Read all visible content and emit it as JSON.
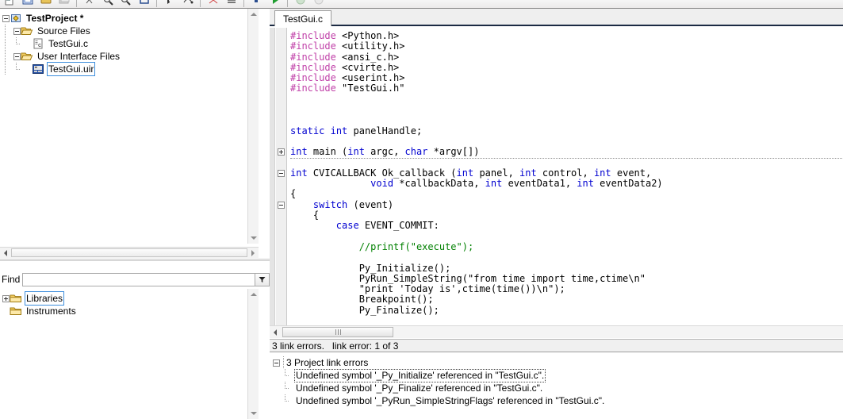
{
  "toolbar": {
    "icons": [
      "new-file-icon",
      "open-file-icon",
      "save-file-icon",
      "save-all-icon",
      "cut-icon",
      "find-icon",
      "find-next-icon",
      "zoom-icon",
      "debug-run-icon",
      "step-over-icon",
      "step-into-icon",
      "breakpoint-icon",
      "compile-icon",
      "run-icon",
      "stop-icon",
      "pause-icon"
    ]
  },
  "project_tree": {
    "nodes": [
      {
        "label": "TestProject *",
        "icon": "project-icon",
        "bold": true,
        "expander": "minus",
        "selected": false,
        "depth": 0
      },
      {
        "label": "Source Files",
        "icon": "folder-open-icon",
        "bold": false,
        "expander": "minus",
        "selected": false,
        "depth": 1
      },
      {
        "label": "TestGui.c",
        "icon": "c-source-icon",
        "bold": false,
        "expander": "none",
        "selected": false,
        "depth": 2
      },
      {
        "label": "User Interface Files",
        "icon": "folder-open-icon",
        "bold": false,
        "expander": "minus",
        "selected": false,
        "depth": 1
      },
      {
        "label": "TestGui.uir",
        "icon": "uir-file-icon",
        "bold": false,
        "expander": "none",
        "selected": true,
        "depth": 2
      }
    ]
  },
  "find": {
    "label": "Find",
    "value": "",
    "placeholder": "",
    "filter_icon": "funnel-icon"
  },
  "library_tree": {
    "nodes": [
      {
        "label": "Libraries",
        "icon": "folder-closed-icon",
        "expander": "plus",
        "selected": true,
        "depth": 0
      },
      {
        "label": "Instruments",
        "icon": "folder-closed-icon",
        "expander": "none",
        "selected": false,
        "depth": 0
      }
    ]
  },
  "editor": {
    "tab_label": "TestGui.c",
    "lines": [
      {
        "fold": "none",
        "segments": [
          {
            "t": "#include",
            "c": "pre"
          },
          {
            "t": " <Python.h>",
            "c": ""
          }
        ]
      },
      {
        "fold": "none",
        "segments": [
          {
            "t": "#include",
            "c": "pre"
          },
          {
            "t": " <utility.h>",
            "c": ""
          }
        ]
      },
      {
        "fold": "none",
        "segments": [
          {
            "t": "#include",
            "c": "pre"
          },
          {
            "t": " <ansi_c.h>",
            "c": ""
          }
        ]
      },
      {
        "fold": "none",
        "segments": [
          {
            "t": "#include",
            "c": "pre"
          },
          {
            "t": " <cvirte.h>",
            "c": ""
          }
        ]
      },
      {
        "fold": "none",
        "segments": [
          {
            "t": "#include",
            "c": "pre"
          },
          {
            "t": " <userint.h>",
            "c": ""
          }
        ]
      },
      {
        "fold": "none",
        "segments": [
          {
            "t": "#include",
            "c": "pre"
          },
          {
            "t": " \"TestGui.h\"",
            "c": ""
          }
        ]
      },
      {
        "fold": "none",
        "segments": [
          {
            "t": "",
            "c": ""
          }
        ]
      },
      {
        "fold": "none",
        "segments": [
          {
            "t": "",
            "c": ""
          }
        ]
      },
      {
        "fold": "none",
        "segments": [
          {
            "t": "",
            "c": ""
          }
        ]
      },
      {
        "fold": "none",
        "segments": [
          {
            "t": "static",
            "c": "kw"
          },
          {
            "t": " ",
            "c": ""
          },
          {
            "t": "int",
            "c": "kw"
          },
          {
            "t": " panelHandle;",
            "c": ""
          }
        ]
      },
      {
        "fold": "none",
        "segments": [
          {
            "t": "",
            "c": ""
          }
        ]
      },
      {
        "fold": "plus",
        "collapsed": true,
        "segments": [
          {
            "t": "int",
            "c": "kw"
          },
          {
            "t": " main (",
            "c": ""
          },
          {
            "t": "int",
            "c": "kw"
          },
          {
            "t": " argc, ",
            "c": ""
          },
          {
            "t": "char",
            "c": "kw"
          },
          {
            "t": " *argv[])",
            "c": ""
          }
        ]
      },
      {
        "fold": "none",
        "segments": [
          {
            "t": "",
            "c": ""
          }
        ]
      },
      {
        "fold": "minus",
        "segments": [
          {
            "t": "int",
            "c": "kw"
          },
          {
            "t": " CVICALLBACK Ok_callback (",
            "c": ""
          },
          {
            "t": "int",
            "c": "kw"
          },
          {
            "t": " panel, ",
            "c": ""
          },
          {
            "t": "int",
            "c": "kw"
          },
          {
            "t": " control, ",
            "c": ""
          },
          {
            "t": "int",
            "c": "kw"
          },
          {
            "t": " event,",
            "c": ""
          }
        ]
      },
      {
        "fold": "none",
        "segments": [
          {
            "t": "              ",
            "c": ""
          },
          {
            "t": "void",
            "c": "kw"
          },
          {
            "t": " *callbackData, ",
            "c": ""
          },
          {
            "t": "int",
            "c": "kw"
          },
          {
            "t": " eventData1, ",
            "c": ""
          },
          {
            "t": "int",
            "c": "kw"
          },
          {
            "t": " eventData2)",
            "c": ""
          }
        ]
      },
      {
        "fold": "none",
        "segments": [
          {
            "t": "{",
            "c": ""
          }
        ]
      },
      {
        "fold": "minus",
        "segments": [
          {
            "t": "    ",
            "c": ""
          },
          {
            "t": "switch",
            "c": "kw"
          },
          {
            "t": " (event)",
            "c": ""
          }
        ]
      },
      {
        "fold": "none",
        "segments": [
          {
            "t": "    {",
            "c": ""
          }
        ]
      },
      {
        "fold": "none",
        "segments": [
          {
            "t": "        ",
            "c": ""
          },
          {
            "t": "case",
            "c": "kw"
          },
          {
            "t": " EVENT_COMMIT:",
            "c": ""
          }
        ]
      },
      {
        "fold": "none",
        "segments": [
          {
            "t": "",
            "c": ""
          }
        ]
      },
      {
        "fold": "none",
        "segments": [
          {
            "t": "            ",
            "c": ""
          },
          {
            "t": "//printf(\"execute\");",
            "c": "cmt"
          }
        ]
      },
      {
        "fold": "none",
        "segments": [
          {
            "t": "",
            "c": ""
          }
        ]
      },
      {
        "fold": "none",
        "segments": [
          {
            "t": "            Py_Initialize();",
            "c": ""
          }
        ]
      },
      {
        "fold": "none",
        "segments": [
          {
            "t": "            PyRun_SimpleString(\"from time import time,ctime\\n\"",
            "c": ""
          }
        ]
      },
      {
        "fold": "none",
        "segments": [
          {
            "t": "            \"print 'Today is',ctime(time())\\n\");",
            "c": ""
          }
        ]
      },
      {
        "fold": "none",
        "segments": [
          {
            "t": "            Breakpoint();",
            "c": ""
          }
        ]
      },
      {
        "fold": "none",
        "segments": [
          {
            "t": "            Py_Finalize();",
            "c": ""
          }
        ]
      }
    ]
  },
  "status": {
    "errors_summary": "3 link errors.",
    "current": "link error:  1 of 3"
  },
  "error_panel": {
    "root": {
      "label": "3 Project link errors",
      "expander": "minus"
    },
    "items": [
      {
        "label": "Undefined symbol '_Py_Initialize' referenced in \"TestGui.c\".",
        "focused": true
      },
      {
        "label": "Undefined symbol '_Py_Finalize' referenced in \"TestGui.c\".",
        "focused": false
      },
      {
        "label": "Undefined symbol '_PyRun_SimpleStringFlags' referenced in \"TestGui.c\".",
        "focused": false
      }
    ]
  },
  "colors": {
    "keyword": "#0000d0",
    "preprocessor": "#c040a8",
    "comment": "#008000",
    "selection_border": "#3c8ddc",
    "tab_underline": "#1c2b44"
  }
}
